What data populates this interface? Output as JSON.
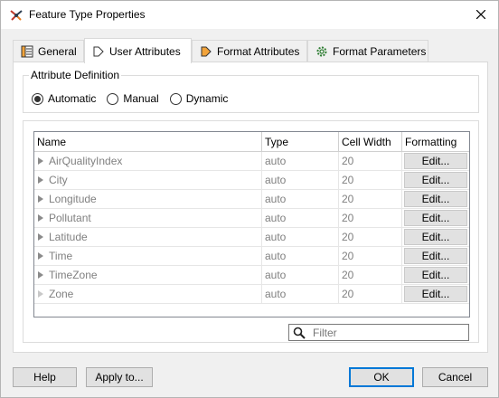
{
  "window": {
    "title": "Feature Type Properties"
  },
  "tabs": [
    {
      "label": "General",
      "icon": "general-icon"
    },
    {
      "label": "User Attributes",
      "icon": "user-attributes-icon"
    },
    {
      "label": "Format Attributes",
      "icon": "format-attributes-icon"
    },
    {
      "label": "Format Parameters",
      "icon": "gear-icon"
    }
  ],
  "active_tab": "User Attributes",
  "attribute_definition": {
    "label": "Attribute Definition",
    "options": [
      "Automatic",
      "Manual",
      "Dynamic"
    ],
    "selected": "Automatic"
  },
  "table": {
    "columns": [
      "Name",
      "Type",
      "Cell Width",
      "Formatting"
    ],
    "rows": [
      {
        "name": "AirQualityIndex",
        "type": "auto",
        "width": "20",
        "format": "Edit..."
      },
      {
        "name": "City",
        "type": "auto",
        "width": "20",
        "format": "Edit..."
      },
      {
        "name": "Longitude",
        "type": "auto",
        "width": "20",
        "format": "Edit..."
      },
      {
        "name": "Pollutant",
        "type": "auto",
        "width": "20",
        "format": "Edit..."
      },
      {
        "name": "Latitude",
        "type": "auto",
        "width": "20",
        "format": "Edit..."
      },
      {
        "name": "Time",
        "type": "auto",
        "width": "20",
        "format": "Edit..."
      },
      {
        "name": "TimeZone",
        "type": "auto",
        "width": "20",
        "format": "Edit..."
      },
      {
        "name": "Zone",
        "type": "auto",
        "width": "20",
        "format": "Edit..."
      }
    ]
  },
  "filter": {
    "placeholder": "Filter"
  },
  "buttons": {
    "help": "Help",
    "apply_to": "Apply to...",
    "ok": "OK",
    "cancel": "Cancel"
  }
}
